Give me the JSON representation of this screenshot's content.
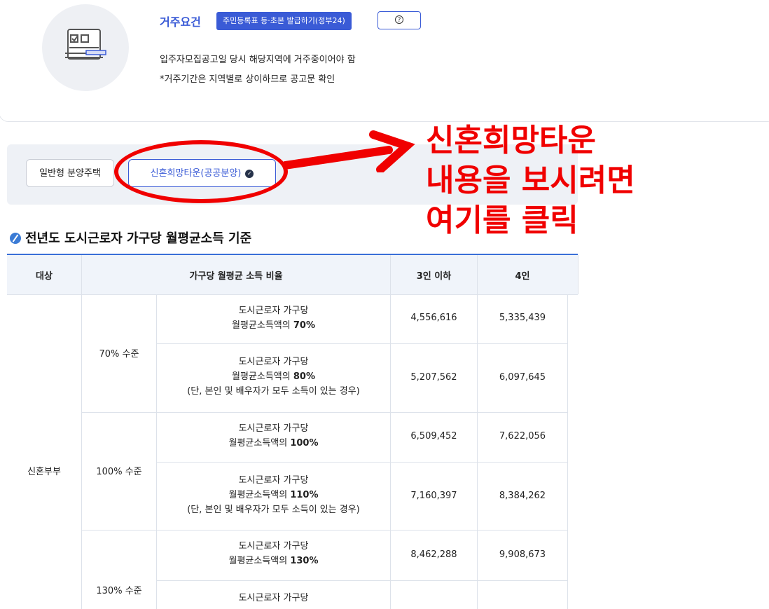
{
  "requirement": {
    "title": "거주요건",
    "issue_button": "주민등록표 등·초본 발급하기(정부24)",
    "help_icon": "?",
    "line1": "입주자모집공고일 당시 해당지역에 거주중이어야 함",
    "line2": "*거주기간은 지역별로 상이하므로 공고문 확인"
  },
  "tabs": [
    {
      "label": "일반형 분양주택"
    },
    {
      "label": "신혼희망타운(공공분양)"
    }
  ],
  "annotation": {
    "line1": "신혼희망타운",
    "line2": "내용을 보시려면",
    "line3": "여기를 클릭",
    "color": "#f00000"
  },
  "section_title": "전년도 도시근로자 가구당 월평균소득 기준",
  "table": {
    "headers": [
      "대상",
      "가구당 월평균 소득 비율",
      "3인 이하",
      "4인"
    ],
    "target": "신혼부부",
    "groups": [
      "70% 수준",
      "100% 수준",
      "130% 수준"
    ],
    "rows": [
      {
        "d1": "도시근로자 가구당",
        "d2a": "월평균소득액의 ",
        "d2b": "70%",
        "d3": "",
        "v3": "4,556,616",
        "v4": "5,335,439"
      },
      {
        "d1": "도시근로자 가구당",
        "d2a": "월평균소득액의 ",
        "d2b": "80%",
        "d3": "(단, 본인 및 배우자가 모두 소득이 있는 경우)",
        "v3": "5,207,562",
        "v4": "6,097,645"
      },
      {
        "d1": "도시근로자 가구당",
        "d2a": "월평균소득액의 ",
        "d2b": "100%",
        "d3": "",
        "v3": "6,509,452",
        "v4": "7,622,056"
      },
      {
        "d1": "도시근로자 가구당",
        "d2a": "월평균소득액의 ",
        "d2b": "110%",
        "d3": "(단, 본인 및 배우자가 모두 소득이 있는 경우)",
        "v3": "7,160,397",
        "v4": "8,384,262"
      },
      {
        "d1": "도시근로자 가구당",
        "d2a": "월평균소득액의 ",
        "d2b": "130%",
        "d3": "",
        "v3": "8,462,288",
        "v4": "9,908,673"
      },
      {
        "d1": "도시근로자 가구당",
        "d2a": "",
        "d2b": "",
        "d3": "",
        "v3": "",
        "v4": ""
      }
    ]
  },
  "colors": {
    "accent": "#3a5bd6",
    "annotation_red": "#f00000"
  }
}
